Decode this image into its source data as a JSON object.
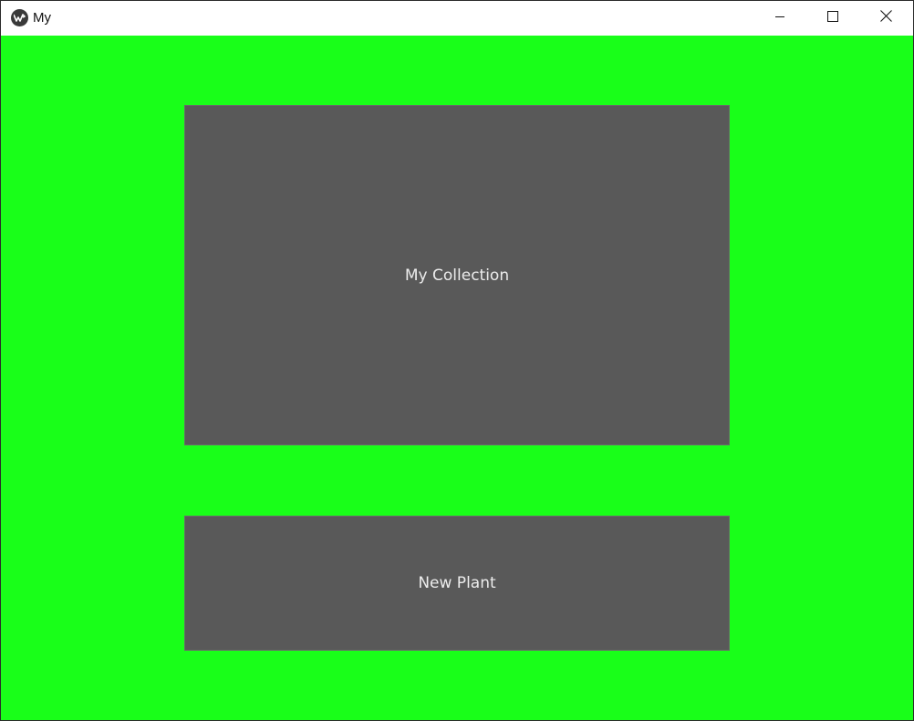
{
  "window": {
    "title": "My",
    "icon": "kivy-logo-icon",
    "controls": {
      "minimize": "minimize-icon",
      "maximize": "maximize-icon",
      "close": "close-icon"
    }
  },
  "colors": {
    "background": "#19ff19",
    "button": "#595959",
    "button_text": "#ececec"
  },
  "main": {
    "collection_button": {
      "label": "My Collection"
    },
    "new_plant_button": {
      "label": "New Plant"
    }
  }
}
